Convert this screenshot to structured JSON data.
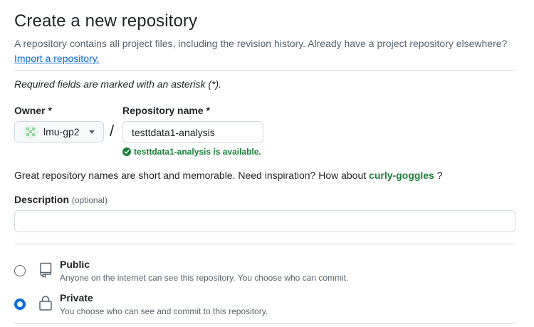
{
  "header": {
    "title": "Create a new repository",
    "subtitle": "A repository contains all project files, including the revision history. Already have a project repository elsewhere?",
    "import_link": "Import a repository."
  },
  "form": {
    "required_note": "Required fields are marked with an asterisk (*).",
    "owner": {
      "label": "Owner *",
      "value": "lmu-gp2",
      "avatar_icon": "identicon-avatar"
    },
    "separator": "/",
    "repo_name": {
      "label": "Repository name *",
      "value": "testtdata1-analysis",
      "availability": "testtdata1-analysis is available."
    },
    "inspiration": {
      "text": "Great repository names are short and memorable. Need inspiration? How about",
      "suggestion": "curly-goggles",
      "trailer": "?"
    },
    "description": {
      "label": "Description",
      "optional": "(optional)",
      "value": "",
      "placeholder": ""
    },
    "visibility": [
      {
        "title": "Public",
        "description": "Anyone on the internet can see this repository. You choose who can commit.",
        "icon": "repo-book-icon",
        "selected": false
      },
      {
        "title": "Private",
        "description": "You choose who can see and commit to this repository.",
        "icon": "lock-icon",
        "selected": true
      }
    ]
  },
  "colors": {
    "accent": "#0969da",
    "success": "#1a7f37",
    "muted_text": "#59636e",
    "border": "#d1d9e0"
  }
}
